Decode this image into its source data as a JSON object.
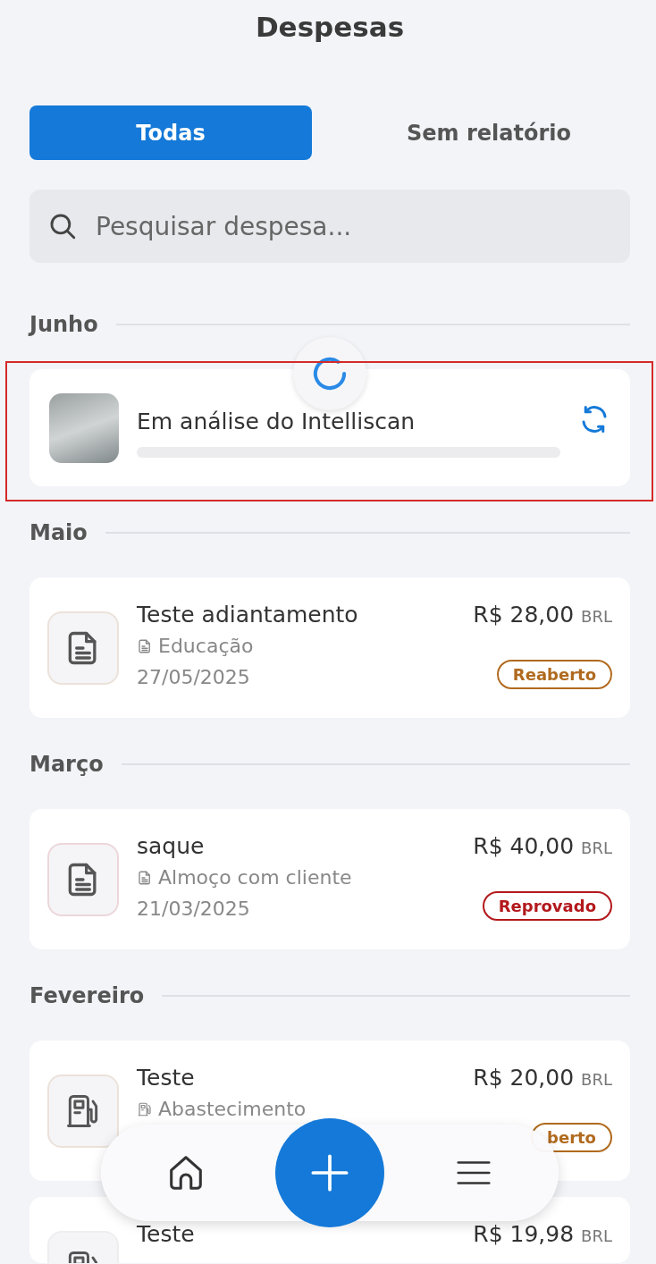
{
  "header": {
    "title": "Despesas"
  },
  "tabs": [
    {
      "label": "Todas",
      "selected": true
    },
    {
      "label": "Sem relatório",
      "selected": false
    }
  ],
  "search": {
    "placeholder": "Pesquisar despesa..."
  },
  "sections": [
    {
      "title": "Junho",
      "items": [
        {
          "kind": "scanning",
          "highlighted": true,
          "label": "Em análise do Intelliscan",
          "level": 0
        }
      ]
    },
    {
      "title": "Maio",
      "items": [
        {
          "kind": "expense",
          "title": "Teste adiantamento",
          "category": "Educação",
          "date": "27/05/2025",
          "amount": "R$ 28,00",
          "currency": "BRL",
          "status": "Reaberto",
          "color": "#b06a1e"
        }
      ]
    },
    {
      "title": "Março",
      "items": [
        {
          "kind": "expense",
          "title": "saque",
          "category": "Almoço com cliente",
          "date": "21/03/2025",
          "amount": "R$ 40,00",
          "currency": "BRL",
          "status": "Reprovado",
          "color": "#b3191c"
        }
      ]
    },
    {
      "title": "Fevereiro",
      "items": [
        {
          "kind": "expense",
          "title": "Teste",
          "category": "Abastecimento",
          "amount": "R$ 20,00",
          "currency": "BRL",
          "status": "berto",
          "color": "#b06a1e"
        },
        {
          "kind": "expense",
          "title": "Teste",
          "amount": "R$ 19,98",
          "currency": "BRL"
        }
      ]
    }
  ]
}
